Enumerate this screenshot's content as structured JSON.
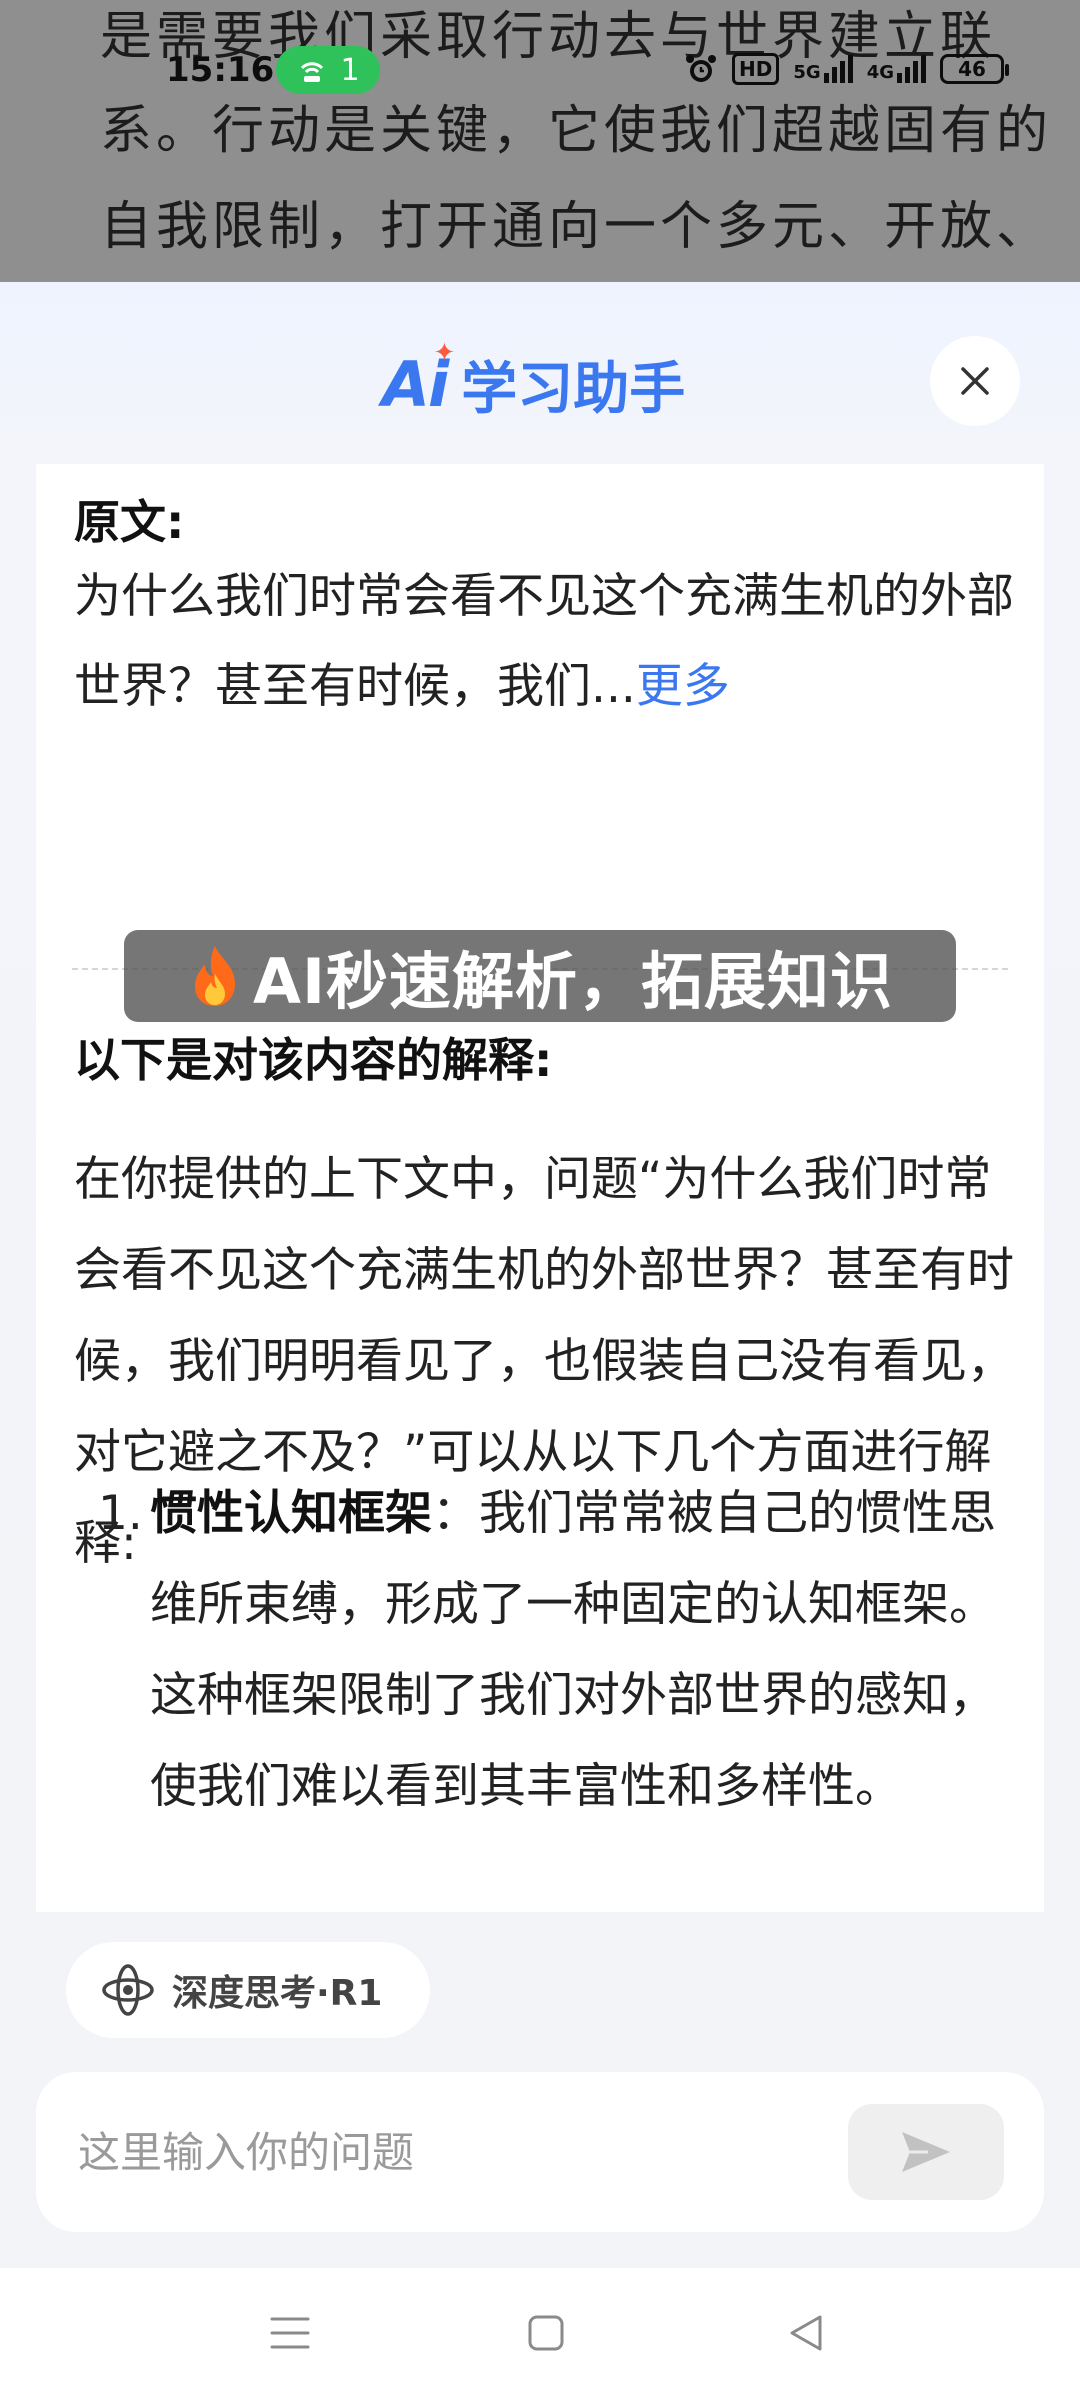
{
  "reader": {
    "lines": [
      "是需要我们采取行动去与世界建立联",
      "系。行动是关键，它使我们超越固有的",
      "自我限制，打开通向一个多元、开放、"
    ]
  },
  "status_bar": {
    "time": "15:16",
    "hotspot_count": "1",
    "hd_label": "HD",
    "net_5g": "5G",
    "net_4g": "4G",
    "battery": "46"
  },
  "sheet": {
    "brand_logo": "Ai",
    "title": "学习助手"
  },
  "original": {
    "label": "原文:",
    "text": "为什么我们时常会看不见这个充满生机的外部世界？甚至有时候，我们...",
    "more": "更多"
  },
  "banner": {
    "text": "AI秒速解析，拓展知识"
  },
  "explanation": {
    "heading": "以下是对该内容的解释:",
    "body": "在你提供的上下文中，问题“为什么我们时常会看不见这个充满生机的外部世界？甚至有时候，我们明明看见了，也假装自己没有看见，对它避之不及？”可以从以下几个方面进行解释:",
    "points": [
      {
        "num": "1.",
        "title": "惯性认知框架",
        "text": "：我们常常被自己的惯性思维所束缚，形成了一种固定的认知框架。这种框架限制了我们对外部世界的感知，使我们难以看到其丰富性和多样性。"
      }
    ]
  },
  "deep_think": {
    "label": "深度思考·R1"
  },
  "input": {
    "placeholder": "这里输入你的问题"
  },
  "colors": {
    "accent": "#3b78f0",
    "hotspot": "#2fc25b",
    "spark": "#ff5a3c"
  }
}
